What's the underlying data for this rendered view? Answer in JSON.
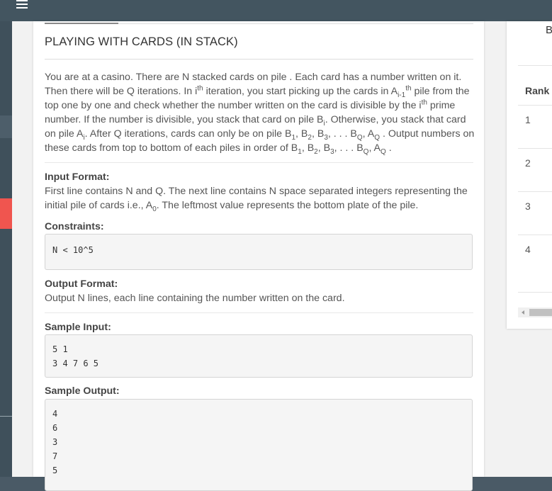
{
  "problem": {
    "title": "PLAYING WITH CARDS (IN STACK)",
    "description": {
      "t1": "You are at a casino. There are N stacked cards on pile . Each card has a number written on it. Then there will be Q iterations. In i",
      "t1_sup": "th",
      "t2": " iteration, you start picking up the cards in A",
      "t2_sub": "i-1",
      "t2_sup": "th",
      "t3": " pile from the top one by one and check whether the number written on the card is divisible by the i",
      "t3_sup": "th",
      "t4": " prime number. If the number is divisible, you stack that card on pile B",
      "t4_sub": "i",
      "t5": ". Otherwise, you stack that card on pile A",
      "t5_sub": "i",
      "t6": ". After Q iterations, cards can only be on pile B",
      "s1": "1",
      "c1": ", B",
      "s2": "2",
      "c2": ", B",
      "s3": "3",
      "c3": ", . . . B",
      "sQ": "Q",
      "c4": ", A",
      "sQ2": "Q",
      "t7": " . Output numbers on these cards from top to bottom of each piles in order of B",
      "u1": "1",
      "d1": ", B",
      "u2": "2",
      "d2": ", B",
      "u3": "3",
      "d3": ", . . . B",
      "uQ": "Q",
      "d4": ", A",
      "uQ2": "Q",
      "t8": " ."
    },
    "input_format": {
      "label": "Input Format:",
      "text1": "First line contains N and Q. The next line contains N space separated integers representing the initial pile of cards i.e., A",
      "sub": "0",
      "text2": ". The leftmost value represents the bottom plate of the pile."
    },
    "constraints": {
      "label": "Constraints:",
      "code": "N < 10^5"
    },
    "output_format": {
      "label": "Output Format:",
      "text": "Output N lines, each line containing the number written on the card."
    },
    "sample_input": {
      "label": "Sample Input:",
      "lines": [
        "5 1",
        "3 4 7 6 5"
      ]
    },
    "sample_output": {
      "label": "Sample Output:",
      "lines": [
        "4",
        "6",
        "3",
        "7",
        "5"
      ]
    }
  },
  "leaderboard": {
    "partial_header": "B",
    "rank_header": "Rank",
    "ranks": [
      "1",
      "2",
      "3",
      "4"
    ]
  }
}
